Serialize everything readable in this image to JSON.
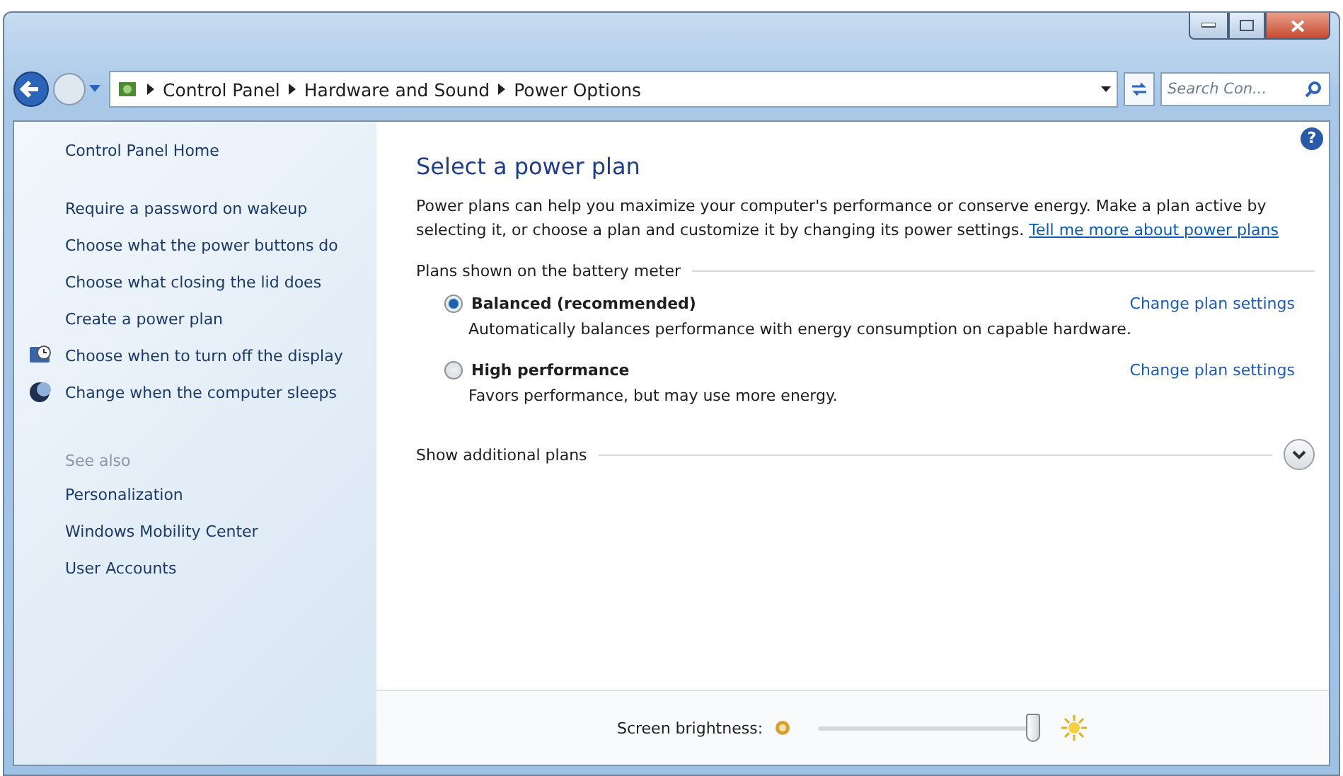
{
  "address_bar": {
    "crumbs": [
      "Control Panel",
      "Hardware and Sound",
      "Power Options"
    ]
  },
  "search": {
    "placeholder": "Search Con..."
  },
  "help": {
    "label": "?"
  },
  "sidebar": {
    "items": [
      {
        "label": "Control Panel Home",
        "kind": "home"
      },
      {
        "label": "Require a password on wakeup",
        "kind": "plain"
      },
      {
        "label": "Choose what the power buttons do",
        "kind": "plain"
      },
      {
        "label": "Choose what closing the lid does",
        "kind": "plain"
      },
      {
        "label": "Create a power plan",
        "kind": "plain"
      },
      {
        "label": "Choose when to turn off the display",
        "kind": "monitor"
      },
      {
        "label": "Change when the computer sleeps",
        "kind": "moon"
      }
    ],
    "see_also": {
      "title": "See also",
      "items": [
        "Personalization",
        "Windows Mobility Center",
        "User Accounts"
      ]
    }
  },
  "main": {
    "title": "Select a power plan",
    "intro": "Power plans can help you maximize your computer's performance or conserve energy. Make a plan active by selecting it, or choose a plan and customize it by changing its power settings.",
    "intro_link": "Tell me more about power plans",
    "group_title": "Plans shown on the battery meter",
    "plans": [
      {
        "name": "Balanced (recommended)",
        "selected": true,
        "description": "Automatically balances performance with energy consumption on capable hardware.",
        "link": "Change plan settings"
      },
      {
        "name": "High performance",
        "selected": false,
        "description": "Favors performance, but may use more energy.",
        "link": "Change plan settings"
      }
    ],
    "more": {
      "label": "Show additional plans",
      "expanded": false
    }
  },
  "brightness": {
    "label": "Screen brightness:",
    "level": 1.0
  }
}
